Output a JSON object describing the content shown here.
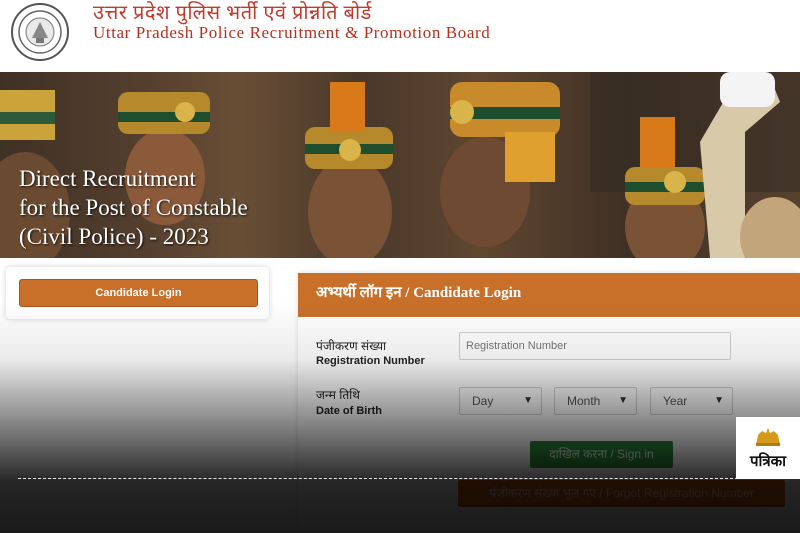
{
  "header": {
    "title_hindi": "उत्तर प्रदेश पुलिस भर्ती एवं प्रोन्नति बोर्ड",
    "title_english": "Uttar Pradesh Police Recruitment & Promotion Board",
    "emblem_icon": "up-police-emblem-icon"
  },
  "banner": {
    "line1": "Direct Recruitment",
    "line2": "for the Post of Constable",
    "line3": "(Civil Police) - 2023"
  },
  "sidebar": {
    "candidate_login_label": "Candidate Login"
  },
  "login": {
    "header": "अभ्यर्थी लॉग इन / Candidate Login",
    "reg_label_hindi": "पंजीकरण संख्या",
    "reg_label_english": "Registration Number",
    "reg_placeholder": "Registration Number",
    "dob_label_hindi": "जन्म तिथि",
    "dob_label_english": "Date of Birth",
    "day_value": "Day",
    "month_value": "Month",
    "year_value": "Year",
    "signin_label": "दाखिल करना / Sign in",
    "forgot_label": "पंजीकरण संख्या भूल गए / Forgot Registration Number"
  },
  "watermark": {
    "logo_text": "पत्रिका",
    "logo_icon": "lion-emblem-icon"
  },
  "colors": {
    "accent_orange": "#c8702a",
    "title_red": "#c0392b",
    "signin_green": "#2e8b3a",
    "forgot_orange": "#d35400"
  }
}
